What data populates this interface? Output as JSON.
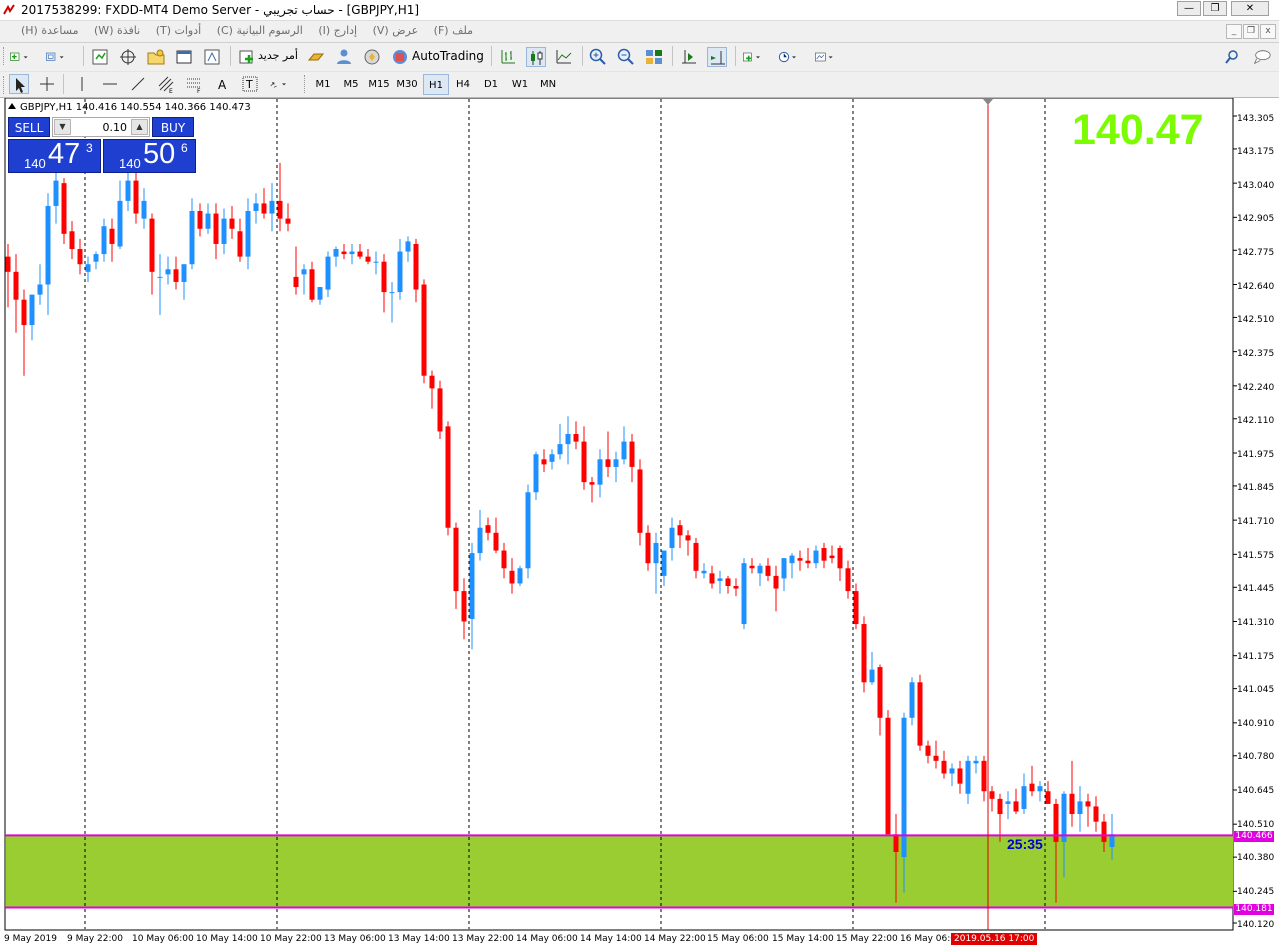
{
  "window": {
    "title": "2017538299: FXDD-MT4 Demo Server - حساب تجريبي - [GBPJPY,H1]",
    "minimize": "—",
    "maximize": "❐",
    "close": "✕"
  },
  "menu": {
    "items": [
      "ملف (F)",
      "عرض (V)",
      "إدارج (I)",
      "الرسوم البيانية (C)",
      "أدوات (T)",
      "نافذة (W)",
      "مساعدة (H)"
    ],
    "mdi": [
      "_",
      "❐",
      "x"
    ]
  },
  "toolbar": {
    "new_order_label": "أمر جديد",
    "autotrading_label": "AutoTrading"
  },
  "timeframes": {
    "items": [
      "M1",
      "M5",
      "M15",
      "M30",
      "H1",
      "H4",
      "D1",
      "W1",
      "MN"
    ],
    "active": "H1"
  },
  "chart": {
    "symbol_line": "GBPJPY,H1  140.416 140.554 140.366 140.473",
    "big_price": "140.47",
    "countdown": "25:35",
    "colors": {
      "bull": "#1e90ff",
      "bear": "#ff0000",
      "zone": "#9acd32",
      "level_line": "#e000e0",
      "big_price": "#7cfc00"
    },
    "price_axis": [
      "143.305",
      "143.175",
      "143.040",
      "142.905",
      "142.775",
      "142.640",
      "142.510",
      "142.375",
      "142.240",
      "142.110",
      "141.975",
      "141.845",
      "141.710",
      "141.575",
      "141.445",
      "141.310",
      "141.175",
      "141.045",
      "140.910",
      "140.780",
      "140.645",
      "140.510",
      "140.380",
      "140.245",
      "140.120"
    ],
    "levels": [
      {
        "label": "140.466",
        "price": 140.466
      },
      {
        "label": "140.181",
        "price": 140.181
      }
    ],
    "time_axis": [
      "9 May 2019",
      "9 May 22:00",
      "10 May 06:00",
      "10 May 14:00",
      "10 May 22:00",
      "13 May 06:00",
      "13 May 14:00",
      "13 May 22:00",
      "14 May 06:00",
      "14 May 14:00",
      "14 May 22:00",
      "15 May 06:00",
      "15 May 14:00",
      "15 May 22:00",
      "16 May 06:00"
    ],
    "current_time_label": "2019.05.16 17:00"
  },
  "one_click": {
    "sell_label": "SELL",
    "buy_label": "BUY",
    "lot": "0.10",
    "sell_prefix": "140",
    "sell_big": "47",
    "sell_sup": "3",
    "buy_prefix": "140",
    "buy_big": "50",
    "buy_sup": "6"
  },
  "chart_data": {
    "type": "candlestick",
    "symbol": "GBPJPY",
    "timeframe": "H1",
    "ylim": [
      140.12,
      143.305
    ],
    "bars": [
      {
        "o": 142.75,
        "h": 142.8,
        "l": 142.55,
        "c": 142.69
      },
      {
        "o": 142.69,
        "h": 142.76,
        "l": 142.45,
        "c": 142.58
      },
      {
        "o": 142.58,
        "h": 142.62,
        "l": 142.28,
        "c": 142.48
      },
      {
        "o": 142.48,
        "h": 142.6,
        "l": 142.42,
        "c": 142.6
      },
      {
        "o": 142.6,
        "h": 142.72,
        "l": 142.56,
        "c": 142.64
      },
      {
        "o": 142.64,
        "h": 143.0,
        "l": 142.52,
        "c": 142.95
      },
      {
        "o": 142.95,
        "h": 143.08,
        "l": 142.88,
        "c": 143.05
      },
      {
        "o": 143.04,
        "h": 143.06,
        "l": 142.8,
        "c": 142.84
      },
      {
        "o": 142.85,
        "h": 142.89,
        "l": 142.74,
        "c": 142.78
      },
      {
        "o": 142.78,
        "h": 142.82,
        "l": 142.68,
        "c": 142.72
      },
      {
        "o": 142.69,
        "h": 142.75,
        "l": 142.65,
        "c": 142.72
      },
      {
        "o": 142.73,
        "h": 142.77,
        "l": 142.7,
        "c": 142.76
      },
      {
        "o": 142.76,
        "h": 142.9,
        "l": 142.73,
        "c": 142.87
      },
      {
        "o": 142.86,
        "h": 142.9,
        "l": 142.73,
        "c": 142.8
      },
      {
        "o": 142.79,
        "h": 143.05,
        "l": 142.78,
        "c": 142.97
      },
      {
        "o": 142.97,
        "h": 143.1,
        "l": 142.93,
        "c": 143.05
      },
      {
        "o": 143.05,
        "h": 143.08,
        "l": 142.88,
        "c": 142.92
      },
      {
        "o": 142.9,
        "h": 143.02,
        "l": 142.86,
        "c": 142.97
      },
      {
        "o": 142.9,
        "h": 142.92,
        "l": 142.6,
        "c": 142.69
      },
      {
        "o": 142.67,
        "h": 142.76,
        "l": 142.52,
        "c": 142.67
      },
      {
        "o": 142.68,
        "h": 142.75,
        "l": 142.64,
        "c": 142.7
      },
      {
        "o": 142.7,
        "h": 142.75,
        "l": 142.62,
        "c": 142.65
      },
      {
        "o": 142.65,
        "h": 142.72,
        "l": 142.58,
        "c": 142.72
      },
      {
        "o": 142.72,
        "h": 142.98,
        "l": 142.7,
        "c": 142.93
      },
      {
        "o": 142.93,
        "h": 142.96,
        "l": 142.83,
        "c": 142.86
      },
      {
        "o": 142.86,
        "h": 142.96,
        "l": 142.84,
        "c": 142.92
      },
      {
        "o": 142.92,
        "h": 142.96,
        "l": 142.74,
        "c": 142.8
      },
      {
        "o": 142.8,
        "h": 142.94,
        "l": 142.76,
        "c": 142.9
      },
      {
        "o": 142.9,
        "h": 142.95,
        "l": 142.82,
        "c": 142.86
      },
      {
        "o": 142.85,
        "h": 142.9,
        "l": 142.73,
        "c": 142.75
      },
      {
        "o": 142.75,
        "h": 142.98,
        "l": 142.7,
        "c": 142.93
      },
      {
        "o": 142.93,
        "h": 143.0,
        "l": 142.88,
        "c": 142.96
      },
      {
        "o": 142.96,
        "h": 143.02,
        "l": 142.9,
        "c": 142.92
      },
      {
        "o": 142.92,
        "h": 143.04,
        "l": 142.85,
        "c": 142.97
      },
      {
        "o": 142.97,
        "h": 143.12,
        "l": 142.85,
        "c": 142.9
      },
      {
        "o": 142.9,
        "h": 142.96,
        "l": 142.85,
        "c": 142.88
      },
      {
        "o": 142.67,
        "h": 142.79,
        "l": 142.6,
        "c": 142.63
      },
      {
        "o": 142.68,
        "h": 142.72,
        "l": 142.6,
        "c": 142.7
      },
      {
        "o": 142.7,
        "h": 142.73,
        "l": 142.57,
        "c": 142.58
      },
      {
        "o": 142.58,
        "h": 142.63,
        "l": 142.56,
        "c": 142.63
      },
      {
        "o": 142.62,
        "h": 142.77,
        "l": 142.59,
        "c": 142.75
      },
      {
        "o": 142.75,
        "h": 142.79,
        "l": 142.71,
        "c": 142.78
      },
      {
        "o": 142.77,
        "h": 142.8,
        "l": 142.74,
        "c": 142.76
      },
      {
        "o": 142.76,
        "h": 142.8,
        "l": 142.72,
        "c": 142.77
      },
      {
        "o": 142.77,
        "h": 142.8,
        "l": 142.74,
        "c": 142.75
      },
      {
        "o": 142.75,
        "h": 142.78,
        "l": 142.72,
        "c": 142.73
      },
      {
        "o": 142.73,
        "h": 142.77,
        "l": 142.68,
        "c": 142.73
      },
      {
        "o": 142.73,
        "h": 142.76,
        "l": 142.53,
        "c": 142.61
      },
      {
        "o": 142.61,
        "h": 142.65,
        "l": 142.49,
        "c": 142.61
      },
      {
        "o": 142.61,
        "h": 142.82,
        "l": 142.58,
        "c": 142.77
      },
      {
        "o": 142.77,
        "h": 142.83,
        "l": 142.73,
        "c": 142.81
      },
      {
        "o": 142.8,
        "h": 142.82,
        "l": 142.57,
        "c": 142.62
      },
      {
        "o": 142.64,
        "h": 142.66,
        "l": 142.25,
        "c": 142.28
      },
      {
        "o": 142.28,
        "h": 142.3,
        "l": 142.15,
        "c": 142.23
      },
      {
        "o": 142.23,
        "h": 142.26,
        "l": 142.03,
        "c": 142.06
      },
      {
        "o": 142.08,
        "h": 142.1,
        "l": 141.65,
        "c": 141.68
      },
      {
        "o": 141.68,
        "h": 141.7,
        "l": 141.36,
        "c": 141.43
      },
      {
        "o": 141.43,
        "h": 141.48,
        "l": 141.24,
        "c": 141.31
      },
      {
        "o": 141.32,
        "h": 141.62,
        "l": 141.2,
        "c": 141.58
      },
      {
        "o": 141.58,
        "h": 141.75,
        "l": 141.55,
        "c": 141.68
      },
      {
        "o": 141.69,
        "h": 141.72,
        "l": 141.63,
        "c": 141.66
      },
      {
        "o": 141.66,
        "h": 141.72,
        "l": 141.58,
        "c": 141.59
      },
      {
        "o": 141.59,
        "h": 141.62,
        "l": 141.48,
        "c": 141.52
      },
      {
        "o": 141.51,
        "h": 141.56,
        "l": 141.42,
        "c": 141.46
      },
      {
        "o": 141.46,
        "h": 141.53,
        "l": 141.45,
        "c": 141.52
      },
      {
        "o": 141.52,
        "h": 141.85,
        "l": 141.48,
        "c": 141.82
      },
      {
        "o": 141.82,
        "h": 141.98,
        "l": 141.79,
        "c": 141.97
      },
      {
        "o": 141.95,
        "h": 141.99,
        "l": 141.9,
        "c": 141.93
      },
      {
        "o": 141.94,
        "h": 141.99,
        "l": 141.91,
        "c": 141.97
      },
      {
        "o": 141.97,
        "h": 142.09,
        "l": 141.95,
        "c": 142.01
      },
      {
        "o": 142.01,
        "h": 142.12,
        "l": 141.93,
        "c": 142.05
      },
      {
        "o": 142.05,
        "h": 142.1,
        "l": 141.99,
        "c": 142.02
      },
      {
        "o": 142.02,
        "h": 142.08,
        "l": 141.83,
        "c": 141.86
      },
      {
        "o": 141.86,
        "h": 141.88,
        "l": 141.78,
        "c": 141.85
      },
      {
        "o": 141.85,
        "h": 141.99,
        "l": 141.8,
        "c": 141.95
      },
      {
        "o": 141.95,
        "h": 142.06,
        "l": 141.88,
        "c": 141.92
      },
      {
        "o": 141.92,
        "h": 141.98,
        "l": 141.86,
        "c": 141.95
      },
      {
        "o": 141.95,
        "h": 142.08,
        "l": 141.93,
        "c": 142.02
      },
      {
        "o": 142.02,
        "h": 142.05,
        "l": 141.86,
        "c": 141.92
      },
      {
        "o": 141.91,
        "h": 141.95,
        "l": 141.61,
        "c": 141.66
      },
      {
        "o": 141.66,
        "h": 141.69,
        "l": 141.51,
        "c": 141.54
      },
      {
        "o": 141.54,
        "h": 141.66,
        "l": 141.42,
        "c": 141.62
      },
      {
        "o": 141.49,
        "h": 141.59,
        "l": 141.45,
        "c": 141.59
      },
      {
        "o": 141.6,
        "h": 141.72,
        "l": 141.55,
        "c": 141.68
      },
      {
        "o": 141.69,
        "h": 141.71,
        "l": 141.6,
        "c": 141.65
      },
      {
        "o": 141.65,
        "h": 141.67,
        "l": 141.57,
        "c": 141.63
      },
      {
        "o": 141.62,
        "h": 141.64,
        "l": 141.48,
        "c": 141.51
      },
      {
        "o": 141.5,
        "h": 141.54,
        "l": 141.48,
        "c": 141.51
      },
      {
        "o": 141.5,
        "h": 141.53,
        "l": 141.44,
        "c": 141.46
      },
      {
        "o": 141.47,
        "h": 141.51,
        "l": 141.42,
        "c": 141.48
      },
      {
        "o": 141.48,
        "h": 141.49,
        "l": 141.42,
        "c": 141.45
      },
      {
        "o": 141.45,
        "h": 141.48,
        "l": 141.41,
        "c": 141.44
      },
      {
        "o": 141.3,
        "h": 141.56,
        "l": 141.28,
        "c": 141.54
      },
      {
        "o": 141.53,
        "h": 141.56,
        "l": 141.5,
        "c": 141.52
      },
      {
        "o": 141.5,
        "h": 141.54,
        "l": 141.45,
        "c": 141.53
      },
      {
        "o": 141.53,
        "h": 141.56,
        "l": 141.47,
        "c": 141.49
      },
      {
        "o": 141.49,
        "h": 141.53,
        "l": 141.35,
        "c": 141.44
      },
      {
        "o": 141.48,
        "h": 141.56,
        "l": 141.43,
        "c": 141.56
      },
      {
        "o": 141.54,
        "h": 141.58,
        "l": 141.48,
        "c": 141.57
      },
      {
        "o": 141.56,
        "h": 141.59,
        "l": 141.51,
        "c": 141.55
      },
      {
        "o": 141.55,
        "h": 141.6,
        "l": 141.52,
        "c": 141.54
      },
      {
        "o": 141.54,
        "h": 141.61,
        "l": 141.52,
        "c": 141.59
      },
      {
        "o": 141.6,
        "h": 141.62,
        "l": 141.52,
        "c": 141.55
      },
      {
        "o": 141.57,
        "h": 141.61,
        "l": 141.54,
        "c": 141.56
      },
      {
        "o": 141.6,
        "h": 141.61,
        "l": 141.47,
        "c": 141.52
      },
      {
        "o": 141.52,
        "h": 141.55,
        "l": 141.4,
        "c": 141.43
      },
      {
        "o": 141.43,
        "h": 141.46,
        "l": 141.28,
        "c": 141.3
      },
      {
        "o": 141.3,
        "h": 141.33,
        "l": 141.03,
        "c": 141.07
      },
      {
        "o": 141.07,
        "h": 141.19,
        "l": 141.06,
        "c": 141.12
      },
      {
        "o": 141.13,
        "h": 141.14,
        "l": 140.86,
        "c": 140.93
      },
      {
        "o": 140.93,
        "h": 140.96,
        "l": 140.7,
        "c": 140.47
      },
      {
        "o": 140.47,
        "h": 140.55,
        "l": 140.2,
        "c": 140.4
      },
      {
        "o": 140.38,
        "h": 140.95,
        "l": 140.24,
        "c": 140.93
      },
      {
        "o": 140.93,
        "h": 141.09,
        "l": 140.9,
        "c": 141.07
      },
      {
        "o": 141.07,
        "h": 141.1,
        "l": 140.8,
        "c": 140.82
      },
      {
        "o": 140.82,
        "h": 140.84,
        "l": 140.75,
        "c": 140.78
      },
      {
        "o": 140.78,
        "h": 140.84,
        "l": 140.73,
        "c": 140.76
      },
      {
        "o": 140.76,
        "h": 140.8,
        "l": 140.69,
        "c": 140.71
      },
      {
        "o": 140.71,
        "h": 140.75,
        "l": 140.66,
        "c": 140.73
      },
      {
        "o": 140.73,
        "h": 140.76,
        "l": 140.63,
        "c": 140.67
      },
      {
        "o": 140.63,
        "h": 140.78,
        "l": 140.59,
        "c": 140.76
      },
      {
        "o": 140.75,
        "h": 140.78,
        "l": 140.71,
        "c": 140.76
      },
      {
        "o": 140.76,
        "h": 140.78,
        "l": 140.6,
        "c": 140.64
      },
      {
        "o": 140.64,
        "h": 140.66,
        "l": 140.56,
        "c": 140.61
      },
      {
        "o": 140.61,
        "h": 140.63,
        "l": 140.44,
        "c": 140.55
      },
      {
        "o": 140.59,
        "h": 140.64,
        "l": 140.53,
        "c": 140.6
      },
      {
        "o": 140.6,
        "h": 140.65,
        "l": 140.55,
        "c": 140.56
      },
      {
        "o": 140.57,
        "h": 140.71,
        "l": 140.55,
        "c": 140.66
      },
      {
        "o": 140.67,
        "h": 140.74,
        "l": 140.62,
        "c": 140.64
      },
      {
        "o": 140.64,
        "h": 140.68,
        "l": 140.6,
        "c": 140.66
      },
      {
        "o": 140.64,
        "h": 140.68,
        "l": 140.59,
        "c": 140.59
      },
      {
        "o": 140.59,
        "h": 140.61,
        "l": 140.2,
        "c": 140.44
      },
      {
        "o": 140.44,
        "h": 140.64,
        "l": 140.3,
        "c": 140.63
      },
      {
        "o": 140.63,
        "h": 140.76,
        "l": 140.5,
        "c": 140.55
      },
      {
        "o": 140.55,
        "h": 140.66,
        "l": 140.48,
        "c": 140.6
      },
      {
        "o": 140.6,
        "h": 140.63,
        "l": 140.5,
        "c": 140.58
      },
      {
        "o": 140.58,
        "h": 140.62,
        "l": 140.48,
        "c": 140.52
      },
      {
        "o": 140.52,
        "h": 140.55,
        "l": 140.4,
        "c": 140.44
      },
      {
        "o": 140.42,
        "h": 140.55,
        "l": 140.37,
        "c": 140.47
      }
    ]
  }
}
